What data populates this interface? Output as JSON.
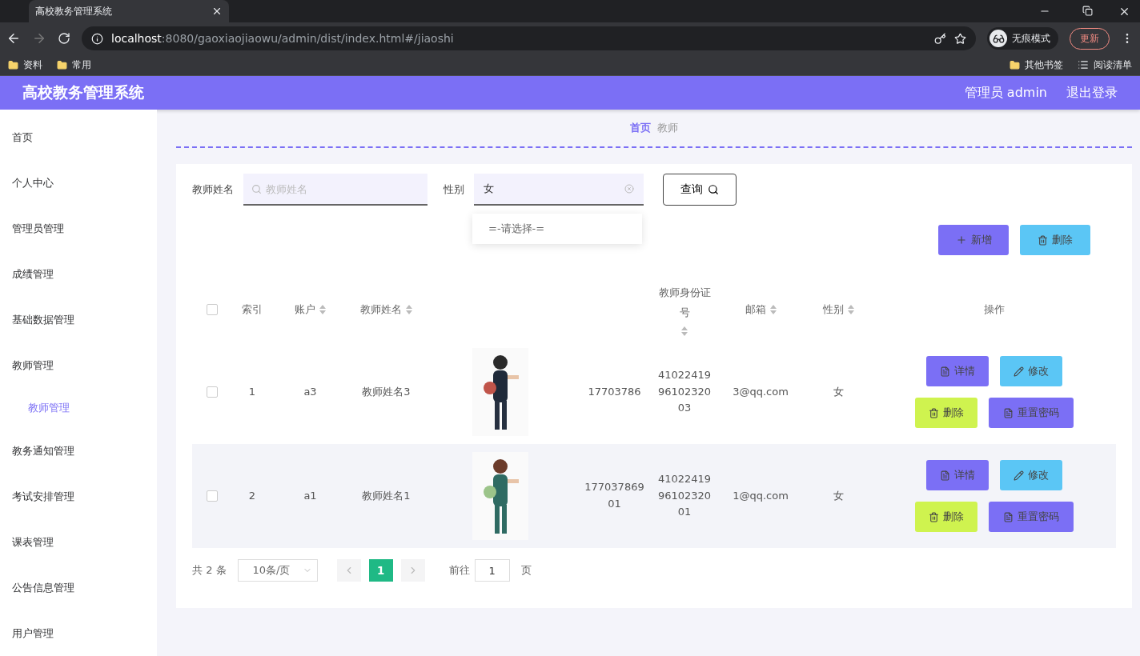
{
  "browser": {
    "tabs": [
      {
        "title": "高校教务管理系统",
        "selected": true
      }
    ],
    "url": {
      "host": "localhost",
      "rest": ":8080/gaoxiaojiaowu/admin/dist/index.html#/jiaoshi"
    },
    "incognito": "无痕模式",
    "update": "更新",
    "bookmarks": [
      "资料",
      "常用"
    ],
    "bookmarks_right": {
      "other": "其他书签",
      "reading": "阅读清单"
    }
  },
  "header": {
    "title": "高校教务管理系统",
    "user": "管理员 admin",
    "logout": "退出登录"
  },
  "sidebar": {
    "items": [
      {
        "label": "首页"
      },
      {
        "label": "个人中心"
      },
      {
        "label": "管理员管理"
      },
      {
        "label": "成绩管理"
      },
      {
        "label": "基础数据管理"
      },
      {
        "label": "教师管理",
        "children": [
          {
            "label": "教师管理",
            "selected": true
          }
        ]
      },
      {
        "label": "教务通知管理"
      },
      {
        "label": "考试安排管理"
      },
      {
        "label": "课表管理"
      },
      {
        "label": "公告信息管理"
      },
      {
        "label": "用户管理"
      }
    ]
  },
  "breadcrumb": [
    "首页",
    "教师"
  ],
  "search": {
    "name_label": "教师姓名",
    "name_placeholder": "教师姓名",
    "gender_label": "性别",
    "gender_value": "女",
    "query": "查询",
    "dropdown": {
      "options": [
        {
          "label": "=-请选择-=",
          "selected": false
        }
      ]
    }
  },
  "actions": {
    "add": "新增",
    "delete": "删除"
  },
  "table": {
    "select_all_checked": false,
    "columns": [
      {
        "label": "索引",
        "sortable": false
      },
      {
        "label": "账户",
        "sortable": true
      },
      {
        "label": "教师姓名",
        "sortable": true
      },
      {
        "label": "教师身份证号",
        "sortable": true
      },
      {
        "label": "邮箱",
        "sortable": true
      },
      {
        "label": "性别",
        "sortable": true
      },
      {
        "label": "操作",
        "sortable": false
      }
    ],
    "rows": [
      {
        "checked": false,
        "index": "1",
        "account": "a3",
        "name": "教师姓名3",
        "phone": "17703786",
        "id_number": "410224199610232003",
        "email": "3@qq.com",
        "gender": "女",
        "buttons": {
          "detail": "详情",
          "edit": "修改",
          "delete": "删除",
          "reset": "重置密码"
        }
      },
      {
        "checked": false,
        "index": "2",
        "account": "a1",
        "name": "教师姓名1",
        "phone": "17703786901",
        "id_number": "410224199610232001",
        "email": "1@qq.com",
        "gender": "女",
        "buttons": {
          "detail": "详情",
          "edit": "修改",
          "delete": "删除",
          "reset": "重置密码"
        }
      }
    ]
  },
  "pagination": {
    "total": "共 2 条",
    "page_size": "10条/页",
    "pages": [
      {
        "label": "1",
        "selected": true
      }
    ],
    "goto": "前往",
    "goto_value": "1",
    "page_suffix": "页"
  }
}
